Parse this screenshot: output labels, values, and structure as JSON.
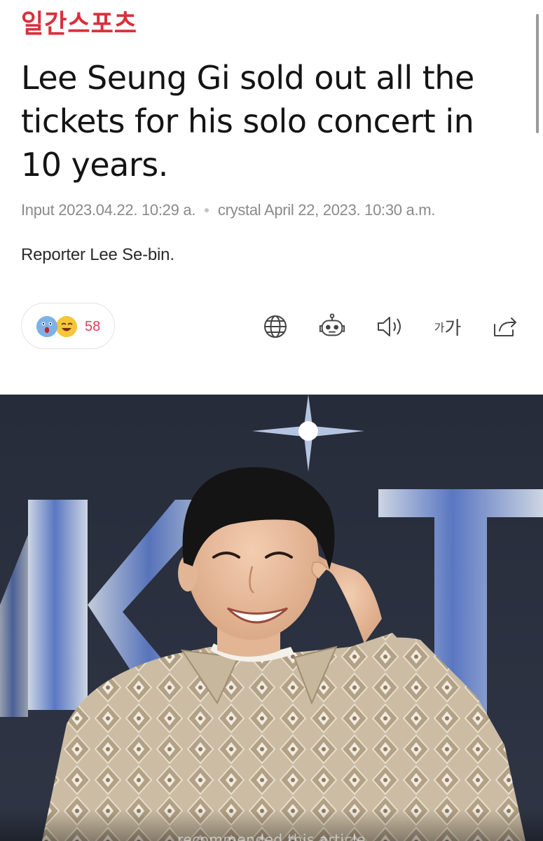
{
  "header": {
    "logo_text": "일간스포츠"
  },
  "article": {
    "title": "Lee Seung Gi sold out all the tickets for his solo concert in 10 years.",
    "meta": {
      "input_label": "Input",
      "input_date": "2023.04.22. 10:29 a.",
      "edit_label": "crystal",
      "edit_date": "April 22, 2023. 10:30 a.m."
    },
    "reporter": "Reporter Lee Se-bin."
  },
  "reactions": {
    "count": "58",
    "emojis": [
      "surprised-face-icon",
      "laughing-face-icon"
    ]
  },
  "toolbar": {
    "icons": [
      "globe-icon",
      "robot-icon",
      "speaker-icon",
      "font-size-icon",
      "share-icon"
    ],
    "font_small": "가",
    "font_big": "가"
  },
  "photo": {
    "caption_overlay": "recommended this article"
  },
  "colors": {
    "brand": "#d9303a",
    "reaction_count": "#e0405a",
    "meta_text": "#8a8a8a"
  }
}
